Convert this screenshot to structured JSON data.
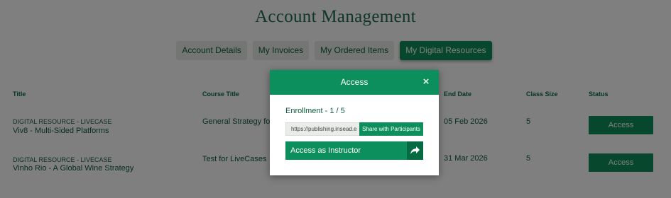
{
  "page_title": "Account Management",
  "tabs": [
    {
      "label": "Account Details",
      "active": false
    },
    {
      "label": "My Invoices",
      "active": false
    },
    {
      "label": "My Ordered Items",
      "active": false
    },
    {
      "label": "My Digital Resources",
      "active": true
    }
  ],
  "table": {
    "headers": {
      "title": "Title",
      "course_title": "Course Title",
      "end_date": "End Date",
      "class_size": "Class Size",
      "status": "Status"
    },
    "rows": [
      {
        "type": "DIGITAL RESOURCE - LIVECASE",
        "name": "Viv8 - Multi-Sided Platforms",
        "course_title": "General Strategy for I",
        "end_date": "05 Feb 2026",
        "class_size": "5",
        "status_label": "Access"
      },
      {
        "type": "DIGITAL RESOURCE - LIVECASE",
        "name": "Vinho Rio - A Global Wine Strategy",
        "course_title": "Test for LiveCases",
        "end_date": "31 Mar 2026",
        "class_size": "5",
        "status_label": "Access"
      }
    ]
  },
  "modal": {
    "title": "Access",
    "close_icon": "close-icon",
    "enrollment": "Enrollment - 1 / 5",
    "url_value": "https://publishing.insead.e",
    "share_label": "Share with Participants",
    "instructor_label": "Access as Instructor",
    "instructor_icon": "share-arrow-icon"
  },
  "colors": {
    "accent": "#0d8f5d",
    "accent_dark": "#066a42",
    "text_green": "#0c5a3a",
    "overlay": "rgba(0,0,0,0.5)"
  }
}
